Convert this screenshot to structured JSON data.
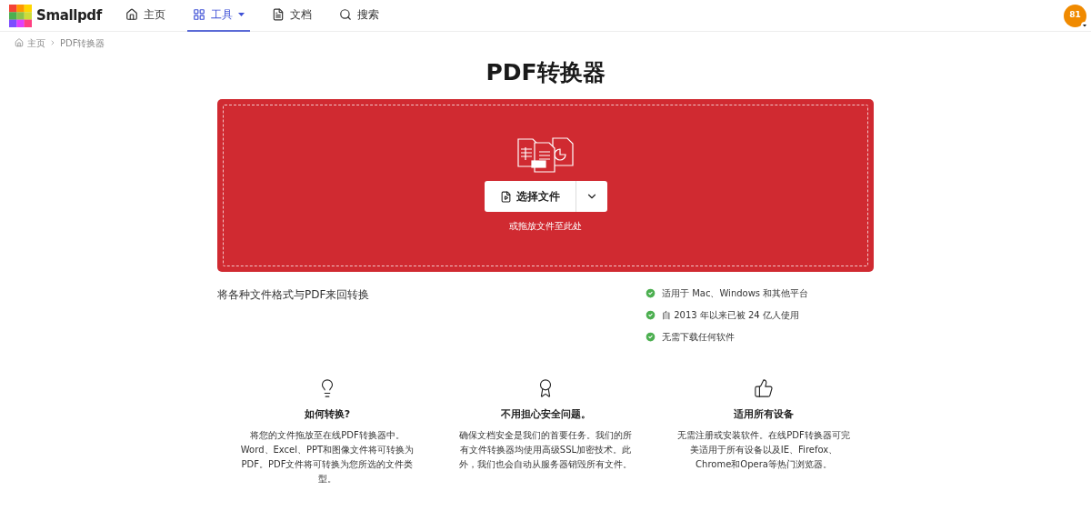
{
  "brand": {
    "name": "Smallpdf"
  },
  "nav": [
    {
      "label": "主页",
      "kind": "home",
      "selected": false,
      "dropdown": false
    },
    {
      "label": "工具",
      "kind": "tools",
      "selected": true,
      "dropdown": true
    },
    {
      "label": "文档",
      "kind": "documents",
      "selected": false,
      "dropdown": false
    },
    {
      "label": "搜索",
      "kind": "search",
      "selected": false,
      "dropdown": false
    }
  ],
  "avatar": {
    "initials": "81"
  },
  "breadcrumb": [
    {
      "label": "主页",
      "kind": "home"
    },
    {
      "label": "PDF转换器",
      "kind": "page"
    }
  ],
  "title": "PDF转换器",
  "dropzone": {
    "button": "选择文件",
    "hint": "或拖放文件至此处"
  },
  "description": "将各种文件格式与PDF来回转换",
  "checklist": [
    "适用于 Mac、Windows 和其他平台",
    "自 2013 年以来已被 24 亿人使用",
    "无需下载任何软件"
  ],
  "features": [
    {
      "kind": "bulb",
      "title": "如何转换?",
      "text": "将您的文件拖放至在线PDF转换器中。Word、Excel、PPT和图像文件将可转换为PDF。PDF文件将可转换为您所选的文件类型。"
    },
    {
      "kind": "award",
      "title": "不用担心安全问题。",
      "text": "确保文档安全是我们的首要任务。我们的所有文件转换器均使用高级SSL加密技术。此外，我们也会自动从服务器销毁所有文件。"
    },
    {
      "kind": "thumb",
      "title": "适用所有设备",
      "text": "无需注册或安装软件。在线PDF转换器可完美适用于所有设备以及IE、Firefox、Chrome和Opera等热门浏览器。"
    }
  ]
}
